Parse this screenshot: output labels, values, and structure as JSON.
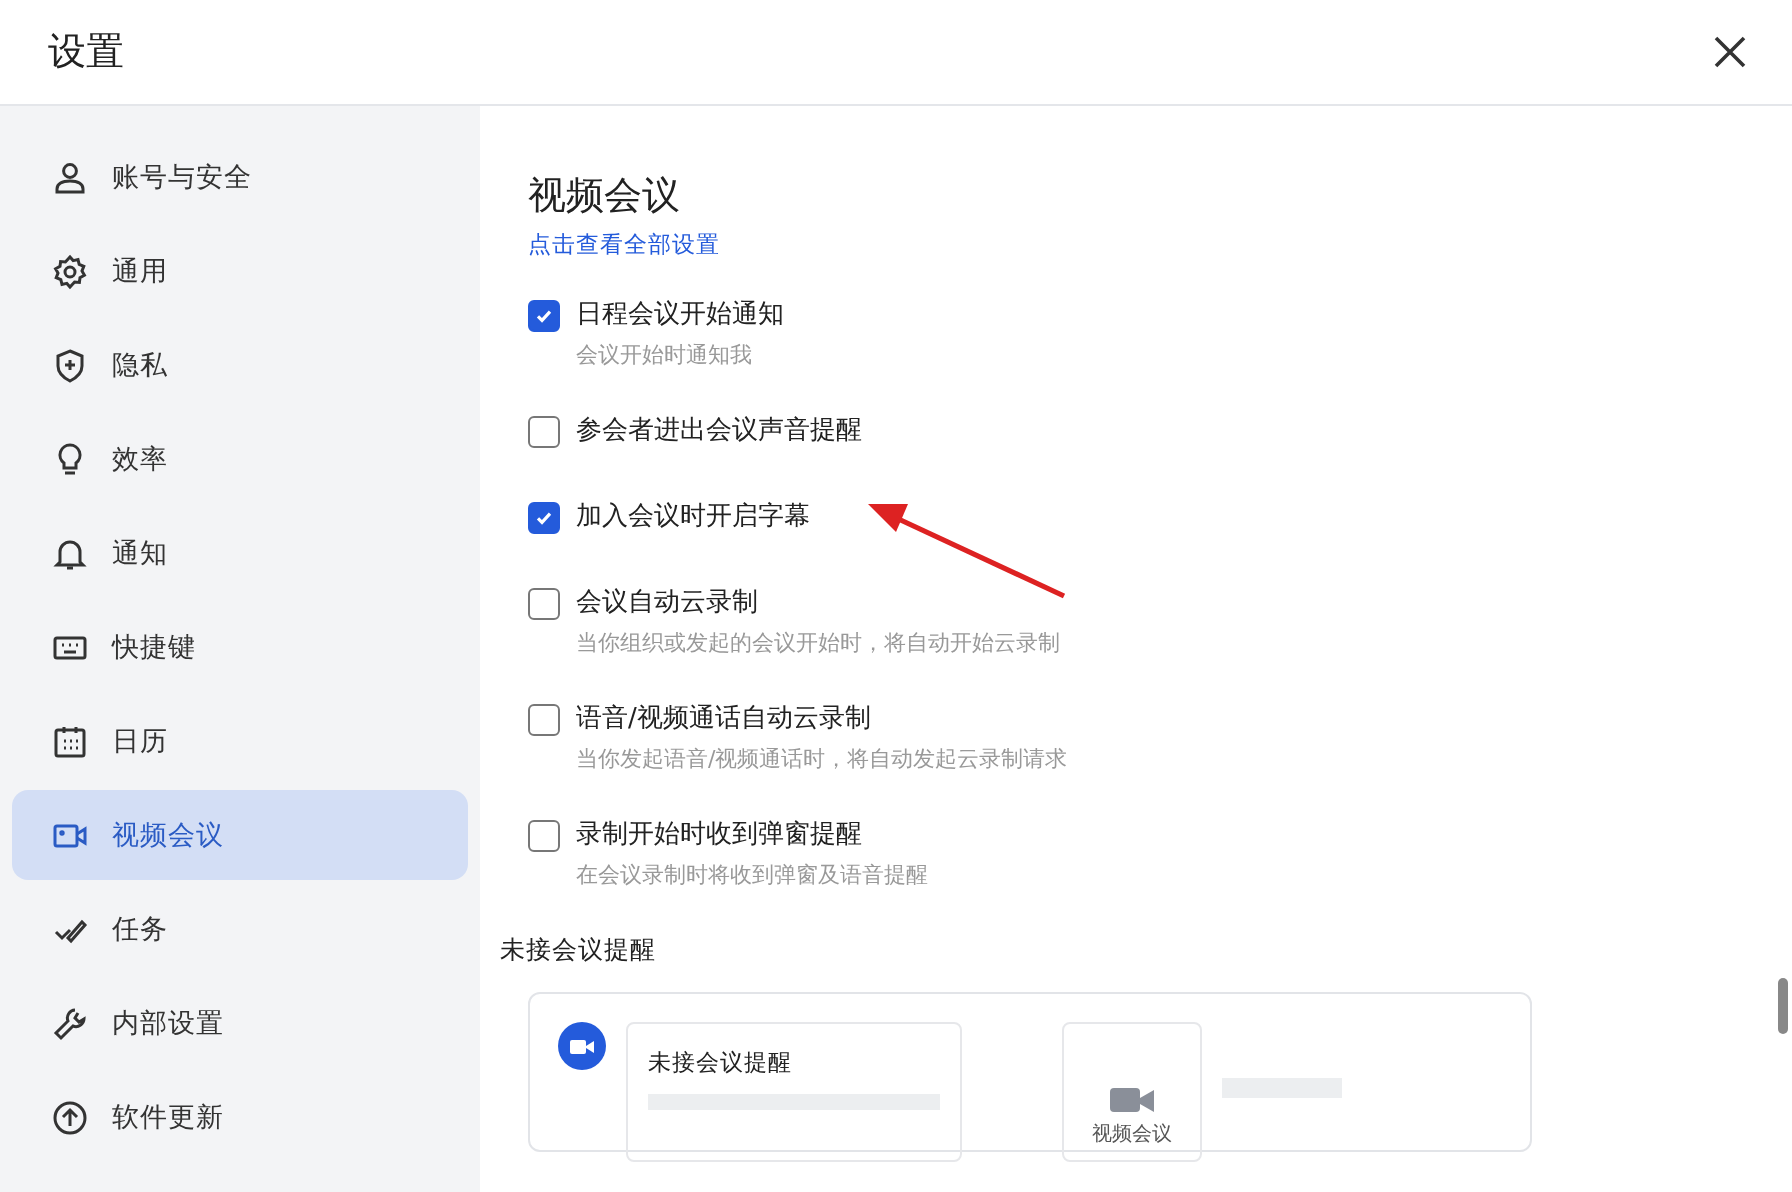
{
  "window": {
    "title": "设置"
  },
  "sidebar": {
    "items": [
      {
        "label": "账号与安全",
        "selected": false
      },
      {
        "label": "通用",
        "selected": false
      },
      {
        "label": "隐私",
        "selected": false
      },
      {
        "label": "效率",
        "selected": false
      },
      {
        "label": "通知",
        "selected": false
      },
      {
        "label": "快捷键",
        "selected": false
      },
      {
        "label": "日历",
        "selected": false
      },
      {
        "label": "视频会议",
        "selected": true
      },
      {
        "label": "任务",
        "selected": false
      },
      {
        "label": "内部设置",
        "selected": false
      },
      {
        "label": "软件更新",
        "selected": false
      }
    ]
  },
  "content": {
    "title": "视频会议",
    "link": "点击查看全部设置",
    "options": [
      {
        "label": "日程会议开始通知",
        "description": "会议开始时通知我",
        "checked": true
      },
      {
        "label": "参会者进出会议声音提醒",
        "checked": false
      },
      {
        "label": "加入会议时开启字幕",
        "checked": true
      },
      {
        "label": "会议自动云录制",
        "description": "当你组织或发起的会议开始时，将自动开始云录制",
        "checked": false
      },
      {
        "label": "语音/视频通话自动云录制",
        "description": "当你发起语音/视频通话时，将自动发起云录制请求",
        "checked": false
      },
      {
        "label": "录制开始时收到弹窗提醒",
        "description": "在会议录制时将收到弹窗及语音提醒",
        "checked": false
      }
    ],
    "missed_section": {
      "heading": "未接会议提醒",
      "preview_title": "未接会议提醒",
      "preview_app_label": "视频会议"
    }
  }
}
